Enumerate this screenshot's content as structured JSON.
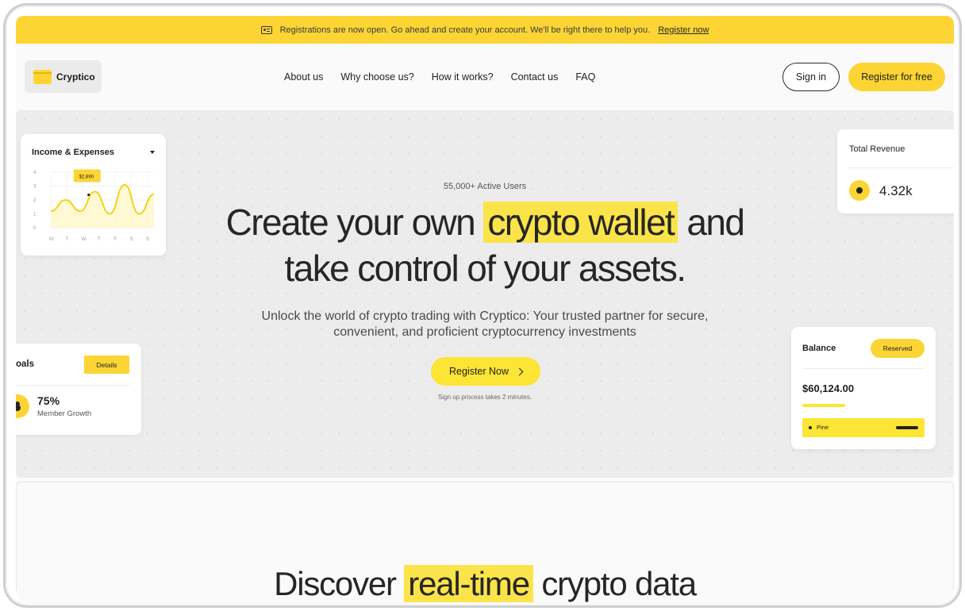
{
  "announcement": {
    "text": "Registrations are now open. Go ahead and create your account. We'll be right there to help you.",
    "link": "Register now"
  },
  "brand": {
    "name": "Cryptico"
  },
  "nav": {
    "links": [
      "About us",
      "Why choose us?",
      "How it works?",
      "Contact us",
      "FAQ"
    ],
    "sign_in": "Sign in",
    "register": "Register for free"
  },
  "hero": {
    "active_users": "55,000+ Active Users",
    "headline_before": "Create your own ",
    "headline_highlight": "crypto wallet",
    "headline_after": " and",
    "headline_line2": "take control of your assets.",
    "subhead_line1": "Unlock the world of crypto trading with Cryptico: Your trusted partner for secure,",
    "subhead_line2": "convenient, and proficient cryptocurrency investments",
    "cta": "Register Now",
    "note": "Sign up process takes 2 minutes."
  },
  "income_card": {
    "title": "Income & Expenses",
    "tooltip": "$2,890"
  },
  "chart_data": {
    "type": "line",
    "title": "Income & Expenses",
    "categories": [
      "M",
      "T",
      "W",
      "T",
      "F",
      "S",
      "S"
    ],
    "y_ticks": [
      "0",
      "1",
      "2",
      "3",
      "4"
    ],
    "ylim": [
      0,
      4
    ],
    "series": [
      {
        "values": [
          1.2,
          2.0,
          1.2,
          2.6,
          1.0,
          3.1,
          1.0,
          2.4
        ]
      }
    ],
    "annotation": "$2,890",
    "grid": true,
    "colors": {
      "line": "#f2d000",
      "fill": "#fff6c2"
    }
  },
  "goals_card": {
    "title": "oals",
    "details": "Details",
    "percent": "75%",
    "label": "Member Growth"
  },
  "revenue_card": {
    "title": "Total Revenue",
    "value": "4.32k"
  },
  "balance_card": {
    "title": "Balance",
    "badge": "Reserved",
    "amount": "$60,124.00",
    "row_label": "Pine"
  },
  "discover": {
    "before": "Discover ",
    "highlight": "real-time",
    "after": " crypto data"
  },
  "colors": {
    "accent": "#fcd535",
    "highlight": "#fbe44a",
    "text": "#262626"
  }
}
